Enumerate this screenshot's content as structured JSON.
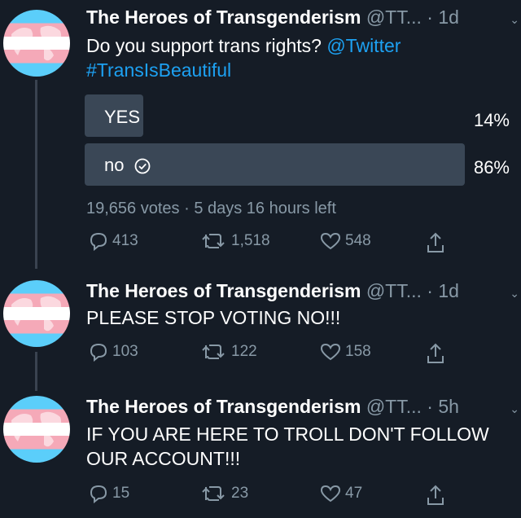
{
  "tweets": [
    {
      "name": "The Heroes of Transgenderism",
      "handle": "@TT...",
      "dot": "·",
      "time": "1d",
      "text_line1": "Do you support trans rights?",
      "mention": "@Twitter",
      "hashtag": "#TransIsBeautiful",
      "poll": {
        "options": [
          {
            "label": "YES",
            "percent": "14%",
            "value": 14,
            "selected": false
          },
          {
            "label": "no",
            "percent": "86%",
            "value": 86,
            "selected": true
          }
        ],
        "votes": "19,656 votes",
        "separator": "·",
        "time_left": "5 days 16 hours left"
      },
      "replies": "413",
      "retweets": "1,518",
      "likes": "548"
    },
    {
      "name": "The Heroes of Transgenderism",
      "handle": "@TT...",
      "dot": "·",
      "time": "1d",
      "text": "PLEASE STOP VOTING NO!!!",
      "replies": "103",
      "retweets": "122",
      "likes": "158"
    },
    {
      "name": "The Heroes of Transgenderism",
      "handle": "@TT...",
      "dot": "·",
      "time": "5h",
      "text_line1": "IF YOU ARE HERE TO TROLL DON'T FOLLOW",
      "text_line2": "OUR ACCOUNT!!!",
      "replies": "15",
      "retweets": "23",
      "likes": "47"
    }
  ],
  "colors": {
    "background": "#151c26",
    "link": "#1da1f2",
    "muted": "#8899a6",
    "poll_bar": "#3a4756"
  },
  "icons": [
    "reply-icon",
    "retweet-icon",
    "like-icon",
    "share-icon",
    "chevron-down-icon",
    "check-circle-icon"
  ]
}
